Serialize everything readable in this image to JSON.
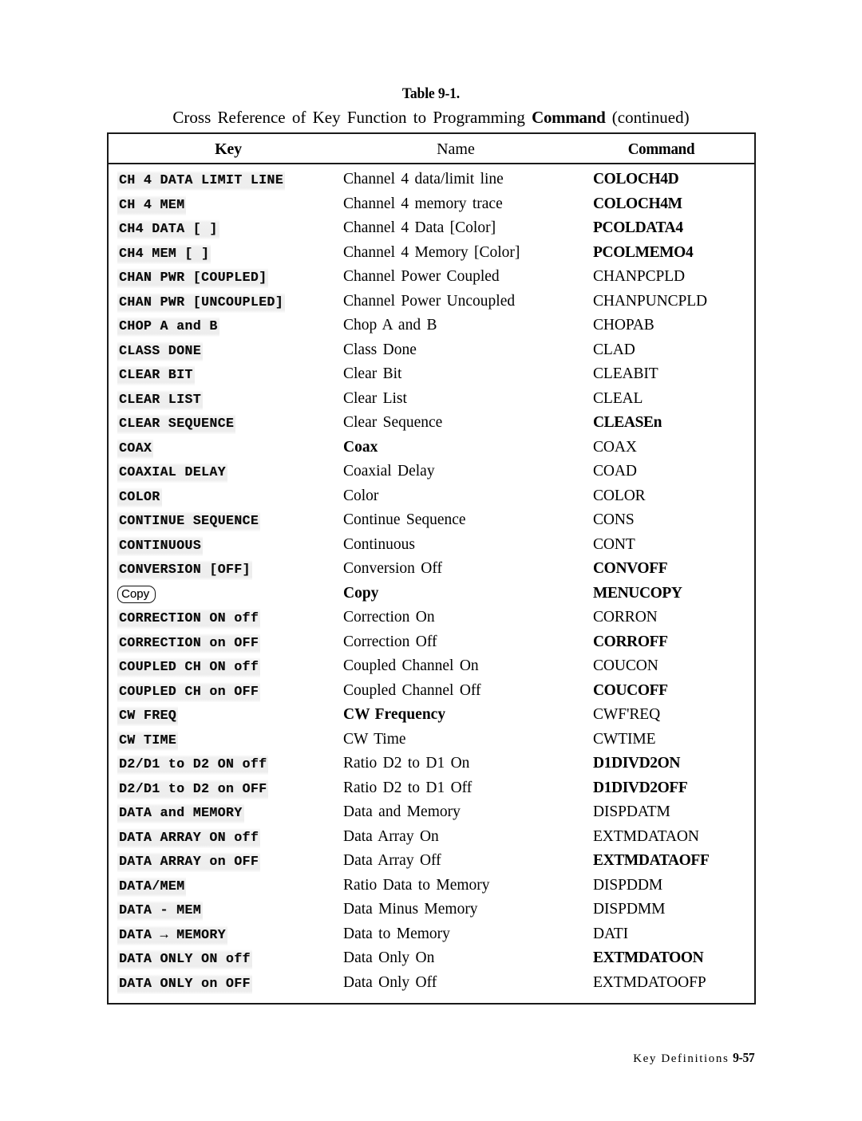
{
  "title": {
    "table_number": "Table 9-1.",
    "caption_prefix": "Cross Reference of Key Function to Programming ",
    "caption_bold": "Command",
    "caption_suffix": " (continued)"
  },
  "table": {
    "headers": {
      "key": "Key",
      "name": "Name",
      "command": "Command"
    },
    "rows": [
      {
        "key": "CH 4 DATA LIMIT LINE",
        "key_style": "softkey",
        "name": "Channel 4 data/limit line",
        "name_bold": false,
        "command": "COLOCH4D",
        "command_bold": true
      },
      {
        "key": "CH 4 MEM",
        "key_style": "softkey",
        "name": "Channel 4 memory trace",
        "name_bold": false,
        "command": "COLOCH4M",
        "command_bold": true
      },
      {
        "key": "CH4 DATA [ ]",
        "key_style": "softkey",
        "name": "Channel 4 Data [Color]",
        "name_bold": false,
        "command": "PCOLDATA4",
        "command_bold": true
      },
      {
        "key": "CH4 MEM [ ]",
        "key_style": "softkey",
        "name": "Channel 4 Memory [Color]",
        "name_bold": false,
        "command": "PCOLMEMO4",
        "command_bold": true
      },
      {
        "key": "CHAN PWR [COUPLED]",
        "key_style": "softkey",
        "name": "Channel Power Coupled",
        "name_bold": false,
        "command": "CHANPCPLD",
        "command_bold": false
      },
      {
        "key": "CHAN PWR [UNCOUPLED]",
        "key_style": "softkey",
        "name": "Channel Power Uncoupled",
        "name_bold": false,
        "command": "CHANPUNCPLD",
        "command_bold": false
      },
      {
        "key": "CHOP A and B",
        "key_style": "softkey",
        "name": "Chop A and B",
        "name_bold": false,
        "command": "CHOPAB",
        "command_bold": false
      },
      {
        "key": "CLASS DONE",
        "key_style": "softkey",
        "name": "Class Done",
        "name_bold": false,
        "command": "CLAD",
        "command_bold": false
      },
      {
        "key": "CLEAR  BIT",
        "key_style": "softkey",
        "name": "Clear Bit",
        "name_bold": false,
        "command": "CLEABIT",
        "command_bold": false
      },
      {
        "key": "CLEAR LIST",
        "key_style": "softkey",
        "name": "Clear List",
        "name_bold": false,
        "command": "CLEAL",
        "command_bold": false
      },
      {
        "key": "CLEAR SEQUENCE",
        "key_style": "softkey",
        "name": "Clear Sequence",
        "name_bold": false,
        "command": "CLEASEn",
        "command_bold": true
      },
      {
        "key": "COAX",
        "key_style": "softkey",
        "name": "Coax",
        "name_bold": true,
        "command": "COAX",
        "command_bold": false
      },
      {
        "key": "COAXIAL DELAY",
        "key_style": "softkey",
        "name": "Coaxial Delay",
        "name_bold": false,
        "command": "COAD",
        "command_bold": false
      },
      {
        "key": "COLOR",
        "key_style": "softkey",
        "name": "Color",
        "name_bold": false,
        "command": "COLOR",
        "command_bold": false
      },
      {
        "key": "CONTINUE SEQUENCE",
        "key_style": "softkey",
        "name": "Continue Sequence",
        "name_bold": false,
        "command": "CONS",
        "command_bold": false
      },
      {
        "key": "CONTINUOUS",
        "key_style": "softkey",
        "name": "Continuous",
        "name_bold": false,
        "command": "CONT",
        "command_bold": false
      },
      {
        "key": "CONVERSION [OFF]",
        "key_style": "softkey",
        "name": "Conversion Off",
        "name_bold": false,
        "command": "CONVOFF",
        "command_bold": true
      },
      {
        "key": "Copy",
        "key_style": "hardkey",
        "name": "Copy",
        "name_bold": true,
        "command": "MENUCOPY",
        "command_bold": true
      },
      {
        "key": "CORRECTION ON off",
        "key_style": "softkey",
        "name": "Correction On",
        "name_bold": false,
        "command": "CORRON",
        "command_bold": false
      },
      {
        "key": "CORRECTION on OFF",
        "key_style": "softkey",
        "name": "Correction Off",
        "name_bold": false,
        "command": "CORROFF",
        "command_bold": true
      },
      {
        "key": "COUPLED CH ON off",
        "key_style": "softkey",
        "name": "Coupled Channel On",
        "name_bold": false,
        "command": "COUCON",
        "command_bold": false
      },
      {
        "key": "COUPLED CH on OFF",
        "key_style": "softkey",
        "name": "Coupled Channel Off",
        "name_bold": false,
        "command": "COUCOFF",
        "command_bold": true
      },
      {
        "key": "CW FREQ",
        "key_style": "softkey",
        "name": "CW Frequency",
        "name_bold": true,
        "command": "CWF'REQ",
        "command_bold": false
      },
      {
        "key": "CW TIME",
        "key_style": "softkey",
        "name": "CW Time",
        "name_bold": false,
        "command": "CWTIME",
        "command_bold": false
      },
      {
        "key": "D2/D1 to D2 ON off",
        "key_style": "softkey",
        "name": "Ratio D2 to D1 On",
        "name_bold": false,
        "command": "D1DIVD2ON",
        "command_bold": true
      },
      {
        "key": "D2/D1 to D2 on OFF",
        "key_style": "softkey",
        "name": "Ratio D2 to D1 Off",
        "name_bold": false,
        "command": "D1DIVD2OFF",
        "command_bold": true
      },
      {
        "key": "DATA and MEMORY",
        "key_style": "softkey",
        "name": "Data and Memory",
        "name_bold": false,
        "command": "DISPDATM",
        "command_bold": false
      },
      {
        "key": "DATA ARRAY ON off",
        "key_style": "softkey",
        "name": "Data Array On",
        "name_bold": false,
        "command": "EXTMDATAON",
        "command_bold": false
      },
      {
        "key": "DATA ARRAY on OFF",
        "key_style": "softkey",
        "name": "Data Array Off",
        "name_bold": false,
        "command": "EXTMDATAOFF",
        "command_bold": true
      },
      {
        "key": "DATA/MEM",
        "key_style": "softkey",
        "name": "Ratio Data to Memory",
        "name_bold": false,
        "command": "DISPDDM",
        "command_bold": false
      },
      {
        "key": "DATA - MEM",
        "key_style": "softkey",
        "name": "Data Minus Memory",
        "name_bold": false,
        "command": "DISPDMM",
        "command_bold": false
      },
      {
        "key": "DATA → MEMORY",
        "key_style": "softkey",
        "name": "Data to Memory",
        "name_bold": false,
        "command": "DATI",
        "command_bold": false
      },
      {
        "key": "DATA ONLY ON off",
        "key_style": "softkey",
        "name": "Data Only On",
        "name_bold": false,
        "command": "EXTMDATOON",
        "command_bold": true
      },
      {
        "key": "DATA ONLY on OFF",
        "key_style": "softkey",
        "name": "Data Only Off",
        "name_bold": false,
        "command": "EXTMDATOOFP",
        "command_bold": false
      }
    ]
  },
  "footer": {
    "section": "Key Definitions",
    "page": "9-57"
  }
}
